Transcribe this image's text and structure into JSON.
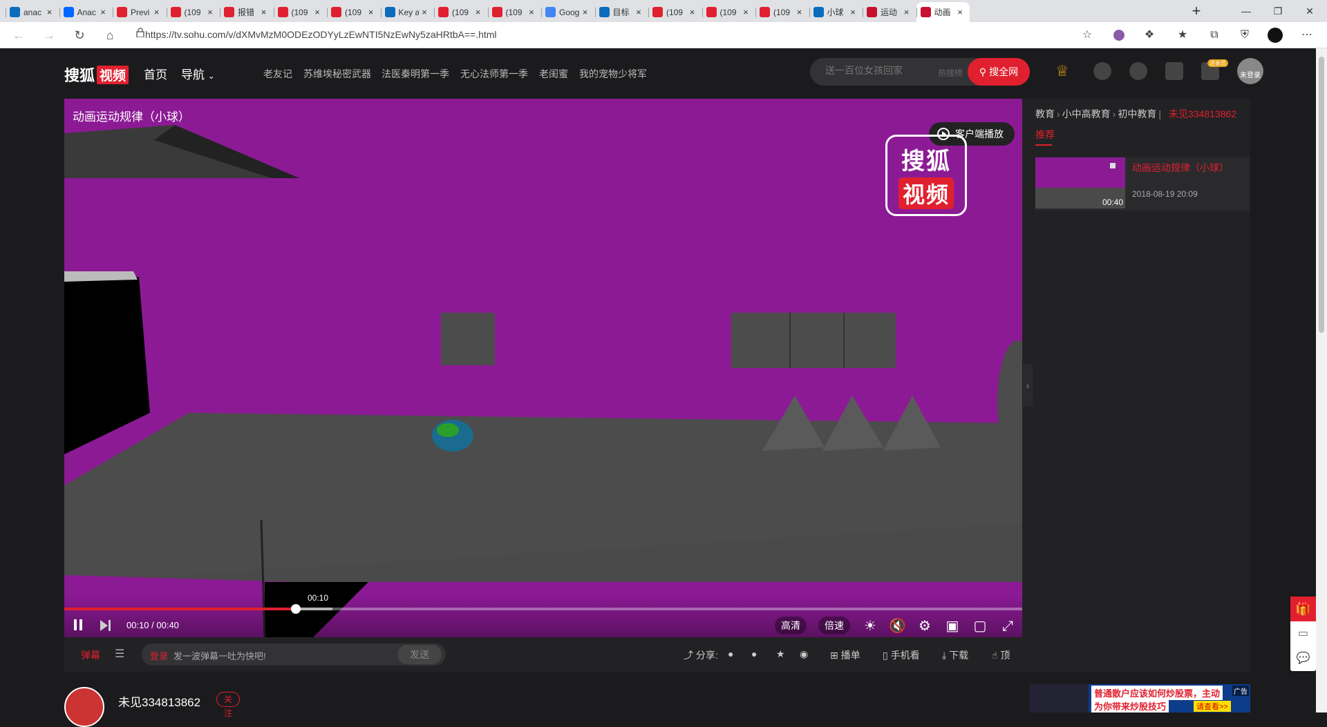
{
  "browser": {
    "tabs": [
      {
        "title": "anac",
        "icon": "bing-icon",
        "color": "#0b6cbd"
      },
      {
        "title": "Anac",
        "icon": "zhihu-icon",
        "color": "#0066ff"
      },
      {
        "title": "Previ",
        "icon": "opera-icon",
        "color": "#e0202f"
      },
      {
        "title": "(109",
        "icon": "csdn-icon",
        "color": "#e0202f"
      },
      {
        "title": "报错",
        "icon": "jianshu-icon",
        "color": "#e0202f"
      },
      {
        "title": "(109",
        "icon": "csdn-icon",
        "color": "#e0202f"
      },
      {
        "title": "(109",
        "icon": "csdn-icon",
        "color": "#e0202f"
      },
      {
        "title": "Key a",
        "icon": "bing-icon",
        "color": "#0b6cbd"
      },
      {
        "title": "(109",
        "icon": "csdn-icon",
        "color": "#e0202f"
      },
      {
        "title": "(109",
        "icon": "csdn-icon",
        "color": "#e0202f"
      },
      {
        "title": "Goog",
        "icon": "translate-icon",
        "color": "#4285f4"
      },
      {
        "title": "目标",
        "icon": "bing-icon",
        "color": "#0b6cbd"
      },
      {
        "title": "(109",
        "icon": "csdn-icon",
        "color": "#e0202f"
      },
      {
        "title": "(109",
        "icon": "csdn-icon",
        "color": "#e0202f"
      },
      {
        "title": "(109",
        "icon": "csdn-icon",
        "color": "#e0202f"
      },
      {
        "title": "小球",
        "icon": "bing-icon",
        "color": "#0b6cbd"
      },
      {
        "title": "运动",
        "icon": "sohu-icon",
        "color": "#c8102e"
      },
      {
        "title": "动画",
        "icon": "sohu-icon",
        "color": "#c8102e",
        "active": true
      }
    ],
    "close_glyph": "×",
    "new_tab": "+",
    "url": "https://tv.sohu.com/v/dXMvMzM0ODEzODYyLzEwNTI5NzEwNy5zaHRtbA==.html"
  },
  "header": {
    "logo_text": "搜狐",
    "logo_badge": "视频",
    "home": "首页",
    "nav": "导航",
    "hot_links": [
      "老友记",
      "苏维埃秘密武器",
      "法医秦明第一季",
      "无心法师第一季",
      "老闺蜜",
      "我的宠物少将军"
    ],
    "search_placeholder": "送一百位女孩回家",
    "hot_search": "热搜榜",
    "search_button": "搜全网",
    "avatar_label": "未登录",
    "vip_badge": "送会员"
  },
  "player": {
    "title": "动画运动规律（小球）",
    "client_play": "客户端播放",
    "watermark_top": "搜狐",
    "watermark_bottom": "视频",
    "hover_time": "00:10",
    "time_display": "00:10 / 00:40",
    "progress": 0.242,
    "buffered": 0.28,
    "quality": "高清",
    "speed": "倍速"
  },
  "sidebar": {
    "breadcrumbs": [
      "教育",
      "小中高教育",
      "初中教育"
    ],
    "uploader": "未见334813862",
    "tab": "推荐",
    "rec": {
      "title": "动画运动规律（小球）",
      "duration": "00:40",
      "date": "2018-08-19 20:09"
    }
  },
  "bottom": {
    "danmu": "弹幕",
    "login": "登录",
    "placeholder": "发一波弹幕一吐为快吧!",
    "send": "发送",
    "share": "分享:",
    "playlist": "播单",
    "mobile": "手机看",
    "download": "下载",
    "like": "顶"
  },
  "uploader": {
    "name": "未见334813862",
    "follow": "关注"
  },
  "ad": {
    "line1": "普通散户应该如何炒股票，主动",
    "line2": "为你带来炒股技巧",
    "button": "请查看>>",
    "tag": "广告"
  }
}
